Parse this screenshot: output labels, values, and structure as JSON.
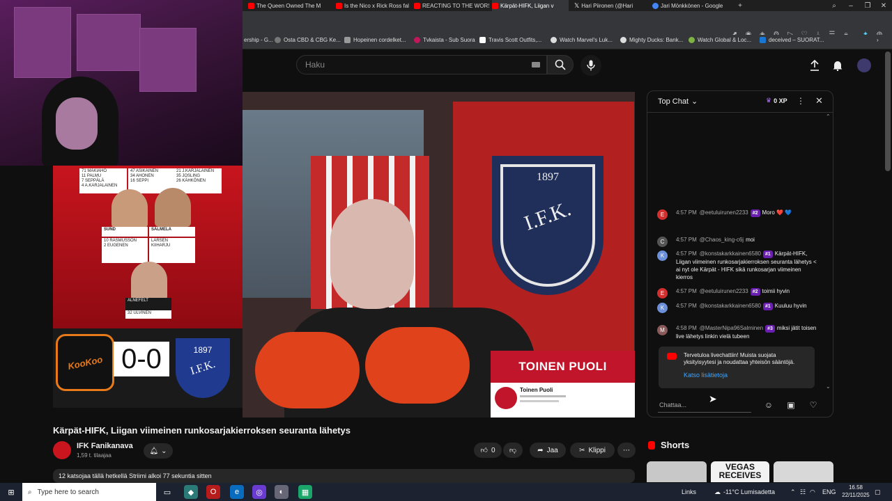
{
  "browser": {
    "tabs": [
      {
        "label": "The Queen Owned The M"
      },
      {
        "label": "Is the Nico x Rick Ross fal"
      },
      {
        "label": "REACTING TO THE WORST"
      },
      {
        "label": "Kärpät-HIFK, Liigan v"
      },
      {
        "label": "Hari Piironen (@Hari"
      },
      {
        "label": "Jari Mönkkönen - Google"
      }
    ],
    "bookmarks": [
      "ership - G...",
      "Osta CBD & CBG Ke...",
      "Hopeinen cordelket...",
      "Tvkaista - Sub Suora",
      "Travis Scott Outfits,...",
      "Watch Marvel's Luk...",
      "Mighty Ducks: Bank...",
      "Watch Global & Loc...",
      "deceived – SUORAT..."
    ]
  },
  "masthead": {
    "search_placeholder": "Haku"
  },
  "video": {
    "title": "Kärpät-HIFK, Liigan viimeinen runkosarjakierroksen seuranta lähetys",
    "channel_name": "IFK Fanikanava",
    "subscribers": "1,59 t. tilaajaa",
    "likes": "0",
    "share_label": "Jaa",
    "clip_label": "Klippi",
    "description": "12 katsojaa tällä hetkellä  Striimi alkoi 77 sekuntia sitten"
  },
  "overlay": {
    "score": "0-0",
    "kookoo_logo_text": "KooKoo",
    "ifk_logo_year": "1897",
    "ifk_logo_text": "I.F.K.",
    "big_emblem_text": "I.F.K.",
    "big_emblem_year": "1897",
    "promo_title": "TOINEN PUOLI",
    "promo_channel": "Toinen Puoli",
    "lineup": {
      "col1": [
        "71 MÄKIAHO",
        "11 PALMU",
        "7 SEPPÄLÄ",
        "4 A.KARJALAINEN"
      ],
      "col2": [
        "47 ASIKAINEN",
        "34 AHONEN",
        "16 SEPPI"
      ],
      "col3": [
        "21 J.KARJALAINEN",
        "35 JOSLING",
        "26 KÄHKÖNEN"
      ],
      "left_player": "SUND",
      "right_player": "SALMELA",
      "left_pair": [
        "10 RASMUSSON",
        "2 EUGENEN"
      ],
      "right_pair": [
        "LARSEN",
        "KIIHARJU"
      ],
      "goalie": "ALNEFELT",
      "goalie_number": "32 ULVINEN"
    }
  },
  "chat": {
    "mode_label": "Top Chat",
    "xp": "0 XP",
    "messages": [
      {
        "initial": "E",
        "time": "4:57 PM",
        "author": "@eetuluirunen2233",
        "badge": "#2",
        "text": "Moro ❤️ 💙",
        "color": "#d32f2f"
      },
      {
        "initial": "C",
        "time": "4:57 PM",
        "author": "@Chaos_king-c6j",
        "badge": "",
        "text": "moi",
        "color": "#555555"
      },
      {
        "initial": "K",
        "time": "4:57 PM",
        "author": "@konstakarkkainen6580",
        "badge": "#1",
        "text": "Kärpät-HIFK, Liigan viimeinen runkosarjakierroksen seuranta lähetys < ai nyt ole Kärpät - HIFK sikä runkosarjan viimeinen kierros",
        "color": "#6b8fd8"
      },
      {
        "initial": "E",
        "time": "4:57 PM",
        "author": "@eetuluirunen2233",
        "badge": "#2",
        "text": "toimii hyvin",
        "color": "#d32f2f"
      },
      {
        "initial": "K",
        "time": "4:57 PM",
        "author": "@konstakarkkainen6580",
        "badge": "#1",
        "text": "Kuuluu hyvin",
        "color": "#6b8fd8"
      },
      {
        "initial": "M",
        "time": "4:58 PM",
        "author": "@MasterNipa96Salminen",
        "badge": "#3",
        "text": "miksi jätit toisen live lähetys linkin vielä tubeen",
        "color": "#8a5a5a"
      }
    ],
    "notice_text": "Tervetuloa livechattiin! Muista suojata yksityisyytesi ja noudattaa yhteisön sääntöjä.",
    "notice_link": "Katso lisätietoja",
    "input_placeholder": "Chattaa..."
  },
  "shorts": {
    "title": "Shorts",
    "thumb_text": "VEGAS RECEIVES"
  },
  "taskbar": {
    "search_placeholder": "Type here to search",
    "links_label": "Links",
    "weather": "-11°C  Lumisadetta",
    "language": "ENG",
    "time": "16.58",
    "date": "22/11/2025"
  },
  "colors": {
    "youtube_red": "#ff0000",
    "accent_link": "#3ea6ff",
    "badge_purple": "#6a1fb0",
    "hifk_red": "#c8151e",
    "ifk_blue": "#1f3a8f"
  }
}
